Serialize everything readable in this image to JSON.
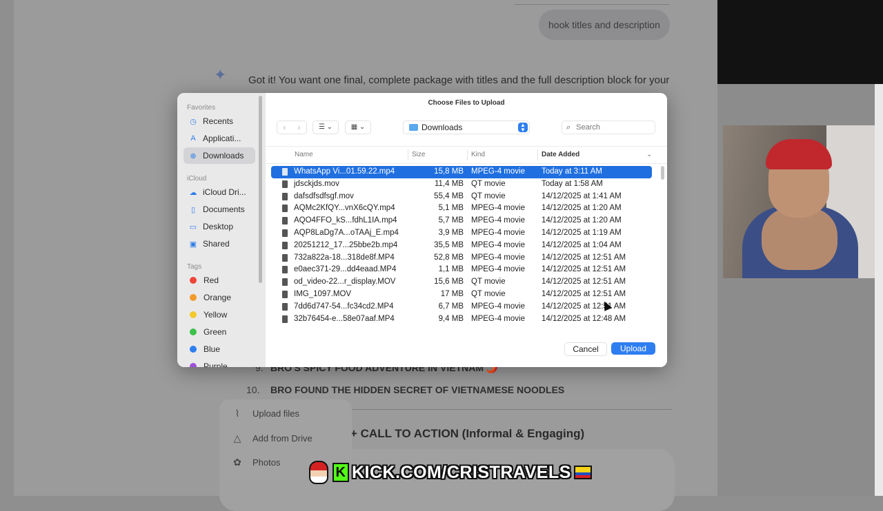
{
  "background_chat": {
    "user_message": "hook titles and description",
    "assistant_reply": "Got it! You want one final, complete package with titles and the full description block for your",
    "titles": [
      {
        "num": "9.",
        "text": "BRO'S SPICY FOOD ADVENTURE IN VIETNAM 🌶️"
      },
      {
        "num": "10.",
        "text": "BRO FOUND THE HIDDEN SECRET OF VIETNAMESE NOODLES"
      }
    ],
    "section_heading": "+ CALL TO ACTION (Informal & Engaging)",
    "upload_menu": [
      {
        "label": "Upload files",
        "icon": "paperclip-icon",
        "glyph": "⌇"
      },
      {
        "label": "Add from Drive",
        "icon": "drive-icon",
        "glyph": "△"
      },
      {
        "label": "Photos",
        "icon": "photos-icon",
        "glyph": "✿"
      }
    ]
  },
  "stream_overlay": {
    "banner_text": "KICK.COM/CRISTRAVELS",
    "kick_letter": "K"
  },
  "dialog": {
    "title": "Choose Files to Upload",
    "location": "Downloads",
    "search_placeholder": "Search",
    "list_view_icon": "☰ ⌄",
    "grid_view_icon": "▦ ⌄",
    "back_glyph": "‹",
    "forward_glyph": "›",
    "columns": {
      "name": "Name",
      "size": "Size",
      "kind": "Kind",
      "date": "Date Added"
    },
    "sidebar": {
      "favorites_label": "Favorites",
      "favorites": [
        {
          "label": "Recents",
          "icon": "clock-icon",
          "glyph": "◷"
        },
        {
          "label": "Applicati...",
          "icon": "applications-icon",
          "glyph": "A"
        },
        {
          "label": "Downloads",
          "icon": "downloads-icon",
          "glyph": "⊕"
        }
      ],
      "icloud_label": "iCloud",
      "icloud": [
        {
          "label": "iCloud Dri...",
          "icon": "cloud-icon",
          "glyph": "☁"
        },
        {
          "label": "Documents",
          "icon": "document-icon",
          "glyph": "▯"
        },
        {
          "label": "Desktop",
          "icon": "desktop-icon",
          "glyph": "▭"
        },
        {
          "label": "Shared",
          "icon": "shared-folder-icon",
          "glyph": "▣"
        }
      ],
      "tags_label": "Tags",
      "tags": [
        {
          "label": "Red",
          "color": "#f0453a"
        },
        {
          "label": "Orange",
          "color": "#f39a2b"
        },
        {
          "label": "Yellow",
          "color": "#f5c92c"
        },
        {
          "label": "Green",
          "color": "#3cc24a"
        },
        {
          "label": "Blue",
          "color": "#2e7ef0"
        },
        {
          "label": "Purple",
          "color": "#a050d8"
        }
      ]
    },
    "files": [
      {
        "name": "WhatsApp Vi...01.59.22.mp4",
        "size": "15,8 MB",
        "kind": "MPEG-4 movie",
        "date": "Today at 3:11 AM",
        "selected": true
      },
      {
        "name": "jdsckjds.mov",
        "size": "11,4 MB",
        "kind": "QT movie",
        "date": "Today at 1:58 AM"
      },
      {
        "name": "dafsdfsdfsgf.mov",
        "size": "55,4 MB",
        "kind": "QT movie",
        "date": "14/12/2025 at 1:41 AM"
      },
      {
        "name": "AQMc2KfQY...vnX6cQY.mp4",
        "size": "5,1 MB",
        "kind": "MPEG-4 movie",
        "date": "14/12/2025 at 1:20 AM"
      },
      {
        "name": "AQO4FFO_kS...fdhL1IA.mp4",
        "size": "5,7 MB",
        "kind": "MPEG-4 movie",
        "date": "14/12/2025 at 1:20 AM"
      },
      {
        "name": "AQP8LaDg7A...oTAAj_E.mp4",
        "size": "3,9 MB",
        "kind": "MPEG-4 movie",
        "date": "14/12/2025 at 1:19 AM"
      },
      {
        "name": "20251212_17...25bbe2b.mp4",
        "size": "35,5 MB",
        "kind": "MPEG-4 movie",
        "date": "14/12/2025 at 1:04 AM"
      },
      {
        "name": "732a822a-18...318de8f.MP4",
        "size": "52,8 MB",
        "kind": "MPEG-4 movie",
        "date": "14/12/2025 at 12:51 AM"
      },
      {
        "name": "e0aec371-29...dd4eaad.MP4",
        "size": "1,1 MB",
        "kind": "MPEG-4 movie",
        "date": "14/12/2025 at 12:51 AM"
      },
      {
        "name": "od_video-22...r_display.MOV",
        "size": "15,6 MB",
        "kind": "QT movie",
        "date": "14/12/2025 at 12:51 AM"
      },
      {
        "name": "IMG_1097.MOV",
        "size": "17 MB",
        "kind": "QT movie",
        "date": "14/12/2025 at 12:51 AM"
      },
      {
        "name": "7dd6d747-54...fc34cd2.MP4",
        "size": "6,7 MB",
        "kind": "MPEG-4 movie",
        "date": "14/12/2025 at 12:51 AM"
      },
      {
        "name": "32b76454-e...58e07aaf.MP4",
        "size": "9,4 MB",
        "kind": "MPEG-4 movie",
        "date": "14/12/2025 at 12:48 AM"
      }
    ],
    "cancel_label": "Cancel",
    "upload_label": "Upload"
  }
}
